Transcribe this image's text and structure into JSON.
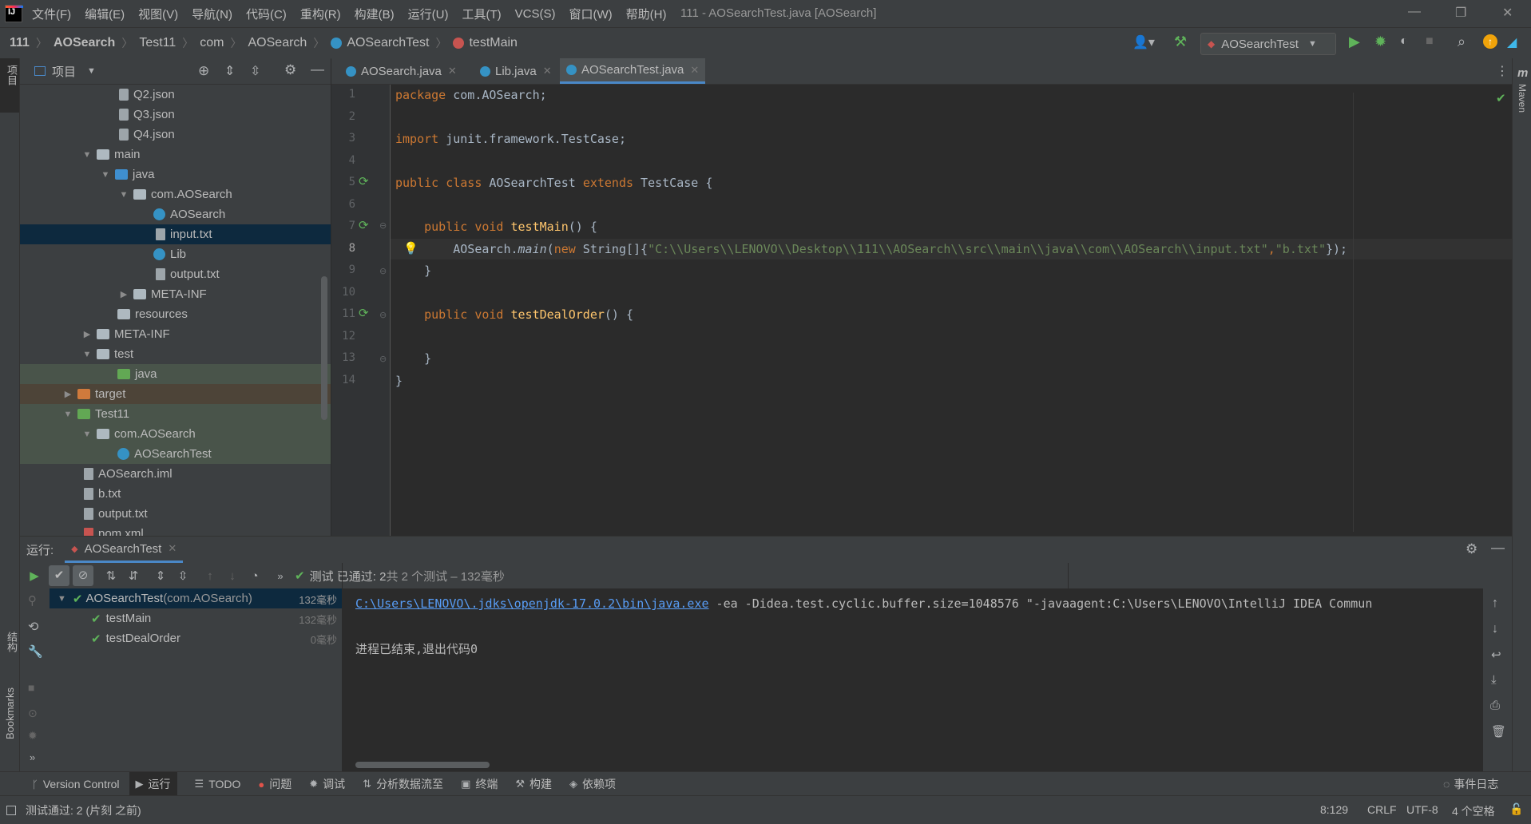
{
  "titlebar": {
    "menu": [
      "文件(F)",
      "编辑(E)",
      "视图(V)",
      "导航(N)",
      "代码(C)",
      "重构(R)",
      "构建(B)",
      "运行(U)",
      "工具(T)",
      "VCS(S)",
      "窗口(W)",
      "帮助(H)"
    ],
    "title": "111 - AOSearchTest.java [AOSearch]"
  },
  "breadcrumbs": [
    "111",
    "AOSearch",
    "Test11",
    "com",
    "AOSearch",
    "AOSearchTest",
    "testMain"
  ],
  "run_config": "AOSearchTest",
  "left_stripe": {
    "project": "项目",
    "structure": "结构",
    "bookmarks": "Bookmarks"
  },
  "right_stripe": {
    "maven": "Maven",
    "m": "m"
  },
  "project_panel": {
    "title": "项目",
    "nodes": [
      {
        "label": "Q2.json"
      },
      {
        "label": "Q3.json"
      },
      {
        "label": "Q4.json"
      },
      {
        "label": "main"
      },
      {
        "label": "java"
      },
      {
        "label": "com.AOSearch"
      },
      {
        "label": "AOSearch"
      },
      {
        "label": "input.txt"
      },
      {
        "label": "Lib"
      },
      {
        "label": "output.txt"
      },
      {
        "label": "META-INF"
      },
      {
        "label": "resources"
      },
      {
        "label": "META-INF"
      },
      {
        "label": "test"
      },
      {
        "label": "java"
      },
      {
        "label": "target"
      },
      {
        "label": "Test11"
      },
      {
        "label": "com.AOSearch"
      },
      {
        "label": "AOSearchTest"
      },
      {
        "label": "AOSearch.iml"
      },
      {
        "label": "b.txt"
      },
      {
        "label": "output.txt"
      },
      {
        "label": "pom.xml"
      }
    ]
  },
  "tabs": [
    {
      "label": "AOSearch.java"
    },
    {
      "label": "Lib.java"
    },
    {
      "label": "AOSearchTest.java"
    }
  ],
  "code": {
    "line_numbers": [
      "1",
      "2",
      "3",
      "4",
      "5",
      "6",
      "7",
      "8",
      "9",
      "10",
      "11",
      "12",
      "13",
      "14"
    ],
    "l1_kw": "package",
    "l1_rest": " com.AOSearch;",
    "l3_kw": "import",
    "l3_rest": " junit.framework.TestCase;",
    "l5_kw1": "public class",
    "l5_mid": " AOSearchTest ",
    "l5_kw2": "extends",
    "l5_rest": " TestCase {",
    "l7_kw": "    public void",
    "l7_fn": " testMain",
    "l7_rest": "() {",
    "l8_a": "        AOSearch.",
    "l8_main": "main",
    "l8_b": "(",
    "l8_new": "new",
    "l8_c": " String[]{",
    "l8_s1": "\"C:\\\\Users\\\\LENOVO\\\\Desktop\\\\111\\\\AOSearch\\\\src\\\\main\\\\java\\\\com\\\\AOSearch\\\\input.txt\"",
    "l8_comma": ",",
    "l8_s2": "\"b.txt\"",
    "l8_end": "});",
    "l9": "    }",
    "l11_kw": "    public void",
    "l11_fn": " testDealOrder",
    "l11_rest": "() {",
    "l13": "    }",
    "l14": "}"
  },
  "run_panel": {
    "label": "运行:",
    "tab": "AOSearchTest",
    "status_prefix": "测试 已通过: 2",
    "status_suffix": "共 2 个测试 – 132毫秒",
    "tree": [
      {
        "name": "AOSearchTest",
        "pkg": " (com.AOSearch)",
        "time": "132毫秒"
      },
      {
        "name": "testMain",
        "time": "132毫秒"
      },
      {
        "name": "testDealOrder",
        "time": "0毫秒"
      }
    ],
    "console_link": "C:\\Users\\LENOVO\\.jdks\\openjdk-17.0.2\\bin\\java.exe",
    "console_args": " -ea -Didea.test.cyclic.buffer.size=1048576 \"-javaagent:C:\\Users\\LENOVO\\IntelliJ IDEA Commun",
    "console_exit": "进程已结束,退出代码0"
  },
  "toolstrip": [
    "Version Control",
    "运行",
    "TODO",
    "问题",
    "调试",
    "分析数据流至",
    "终端",
    "构建",
    "依赖项"
  ],
  "event_log": "事件日志",
  "status": {
    "message": "测试通过: 2 (片刻 之前)",
    "position": "8:129",
    "line_sep": "CRLF",
    "encoding": "UTF-8",
    "indent": "4 个空格"
  },
  "colors": {
    "keyword": "#cc7832",
    "string": "#6a8759",
    "function": "#ffc66d",
    "accent": "#4a88c7",
    "pass": "#5fb35a"
  }
}
